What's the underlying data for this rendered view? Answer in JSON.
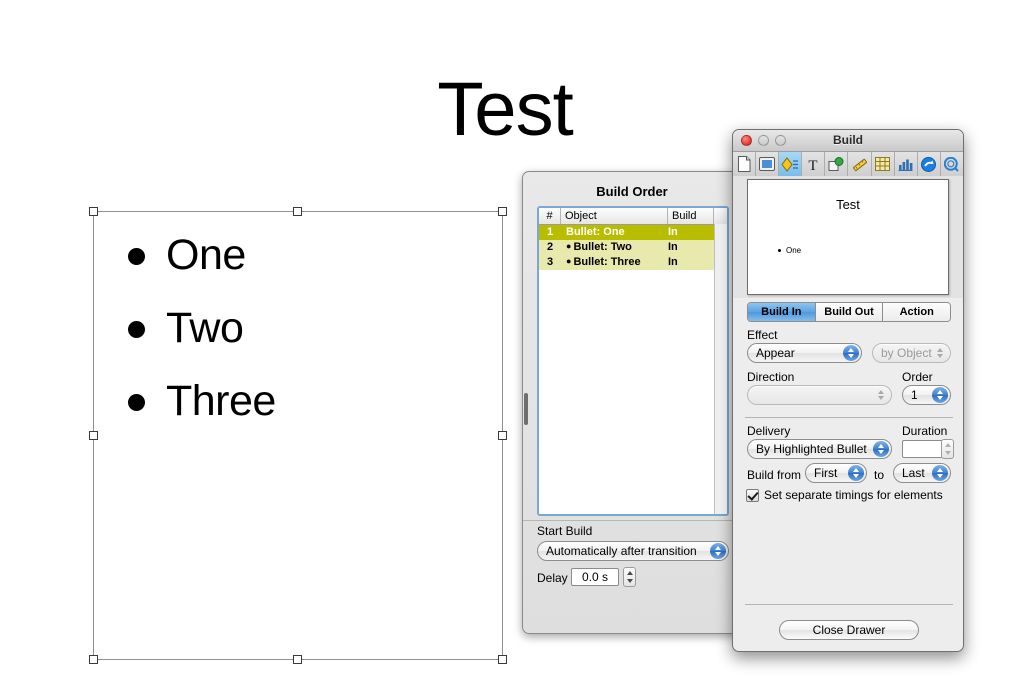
{
  "slide": {
    "title": "Test",
    "bullets": [
      "One",
      "Two",
      "Three"
    ]
  },
  "build_order_panel": {
    "title": "Build Order",
    "columns": [
      "#",
      "Object",
      "Build"
    ],
    "rows": [
      {
        "num": "1",
        "object": "Bullet: One",
        "build": "In",
        "selected": true,
        "sub": false
      },
      {
        "num": "2",
        "object": "Bullet: Two",
        "build": "In",
        "selected": false,
        "sub": true
      },
      {
        "num": "3",
        "object": "Bullet: Three",
        "build": "In",
        "selected": false,
        "sub": true
      }
    ],
    "start_build_label": "Start Build",
    "start_build_value": "Automatically after transition",
    "delay_label": "Delay",
    "delay_value": "0.0 s"
  },
  "build_window": {
    "title": "Build",
    "toolbar": [
      {
        "name": "document-icon",
        "active": false
      },
      {
        "name": "slide-icon",
        "active": false
      },
      {
        "name": "build-icon",
        "active": true
      },
      {
        "name": "text-icon",
        "active": false
      },
      {
        "name": "graphic-icon",
        "active": false
      },
      {
        "name": "metrics-icon",
        "active": false
      },
      {
        "name": "table-icon",
        "active": false
      },
      {
        "name": "chart-icon",
        "active": false
      },
      {
        "name": "hyperlink-icon",
        "active": false
      },
      {
        "name": "quicktime-icon",
        "active": false
      }
    ],
    "preview": {
      "title": "Test",
      "bullet": "One"
    },
    "tabs": [
      {
        "label": "Build In",
        "active": true
      },
      {
        "label": "Build Out",
        "active": false
      },
      {
        "label": "Action",
        "active": false
      }
    ],
    "effect_label": "Effect",
    "effect_value": "Appear",
    "effect_by_value": "by Object",
    "direction_label": "Direction",
    "direction_value": "",
    "order_label": "Order",
    "order_value": "1",
    "delivery_label": "Delivery",
    "delivery_value": "By Highlighted Bullet",
    "duration_label": "Duration",
    "duration_value": "",
    "build_from_label": "Build from",
    "build_from_value": "First",
    "to_label": "to",
    "build_to_value": "Last",
    "separate_timings_label": "Set separate timings for elements",
    "close_drawer_label": "Close Drawer"
  },
  "colors": {
    "selected_row": "#b9bd00",
    "tinted_row": "#e8e9ad",
    "tab_active": "#5ba3e2",
    "popup_arrow_blue": "#3f82d2",
    "table_focus_border": "#7aa7d4"
  }
}
